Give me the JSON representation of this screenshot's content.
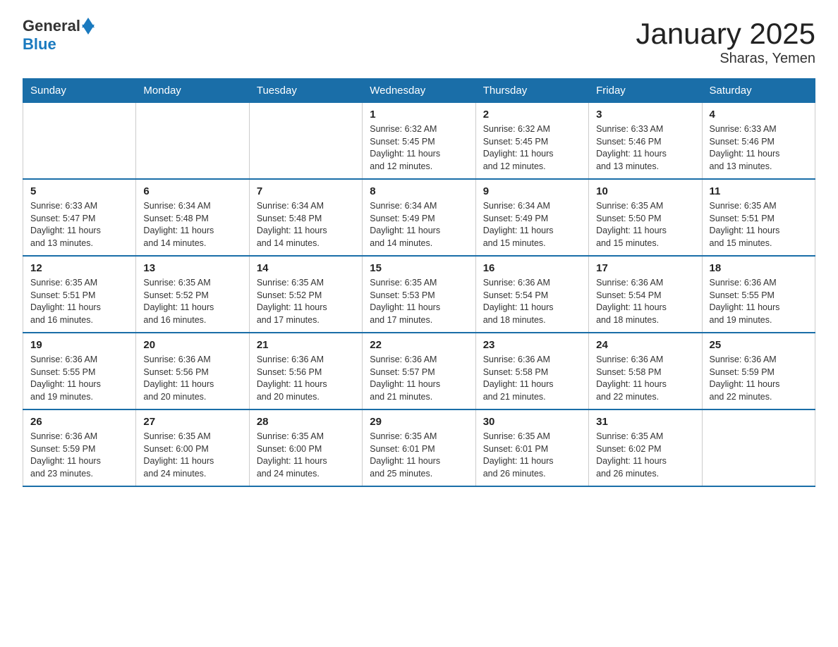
{
  "header": {
    "logo_general": "General",
    "logo_blue": "Blue",
    "month_title": "January 2025",
    "location": "Sharas, Yemen"
  },
  "days_of_week": [
    "Sunday",
    "Monday",
    "Tuesday",
    "Wednesday",
    "Thursday",
    "Friday",
    "Saturday"
  ],
  "weeks": [
    [
      {
        "day": "",
        "info": ""
      },
      {
        "day": "",
        "info": ""
      },
      {
        "day": "",
        "info": ""
      },
      {
        "day": "1",
        "info": "Sunrise: 6:32 AM\nSunset: 5:45 PM\nDaylight: 11 hours\nand 12 minutes."
      },
      {
        "day": "2",
        "info": "Sunrise: 6:32 AM\nSunset: 5:45 PM\nDaylight: 11 hours\nand 12 minutes."
      },
      {
        "day": "3",
        "info": "Sunrise: 6:33 AM\nSunset: 5:46 PM\nDaylight: 11 hours\nand 13 minutes."
      },
      {
        "day": "4",
        "info": "Sunrise: 6:33 AM\nSunset: 5:46 PM\nDaylight: 11 hours\nand 13 minutes."
      }
    ],
    [
      {
        "day": "5",
        "info": "Sunrise: 6:33 AM\nSunset: 5:47 PM\nDaylight: 11 hours\nand 13 minutes."
      },
      {
        "day": "6",
        "info": "Sunrise: 6:34 AM\nSunset: 5:48 PM\nDaylight: 11 hours\nand 14 minutes."
      },
      {
        "day": "7",
        "info": "Sunrise: 6:34 AM\nSunset: 5:48 PM\nDaylight: 11 hours\nand 14 minutes."
      },
      {
        "day": "8",
        "info": "Sunrise: 6:34 AM\nSunset: 5:49 PM\nDaylight: 11 hours\nand 14 minutes."
      },
      {
        "day": "9",
        "info": "Sunrise: 6:34 AM\nSunset: 5:49 PM\nDaylight: 11 hours\nand 15 minutes."
      },
      {
        "day": "10",
        "info": "Sunrise: 6:35 AM\nSunset: 5:50 PM\nDaylight: 11 hours\nand 15 minutes."
      },
      {
        "day": "11",
        "info": "Sunrise: 6:35 AM\nSunset: 5:51 PM\nDaylight: 11 hours\nand 15 minutes."
      }
    ],
    [
      {
        "day": "12",
        "info": "Sunrise: 6:35 AM\nSunset: 5:51 PM\nDaylight: 11 hours\nand 16 minutes."
      },
      {
        "day": "13",
        "info": "Sunrise: 6:35 AM\nSunset: 5:52 PM\nDaylight: 11 hours\nand 16 minutes."
      },
      {
        "day": "14",
        "info": "Sunrise: 6:35 AM\nSunset: 5:52 PM\nDaylight: 11 hours\nand 17 minutes."
      },
      {
        "day": "15",
        "info": "Sunrise: 6:35 AM\nSunset: 5:53 PM\nDaylight: 11 hours\nand 17 minutes."
      },
      {
        "day": "16",
        "info": "Sunrise: 6:36 AM\nSunset: 5:54 PM\nDaylight: 11 hours\nand 18 minutes."
      },
      {
        "day": "17",
        "info": "Sunrise: 6:36 AM\nSunset: 5:54 PM\nDaylight: 11 hours\nand 18 minutes."
      },
      {
        "day": "18",
        "info": "Sunrise: 6:36 AM\nSunset: 5:55 PM\nDaylight: 11 hours\nand 19 minutes."
      }
    ],
    [
      {
        "day": "19",
        "info": "Sunrise: 6:36 AM\nSunset: 5:55 PM\nDaylight: 11 hours\nand 19 minutes."
      },
      {
        "day": "20",
        "info": "Sunrise: 6:36 AM\nSunset: 5:56 PM\nDaylight: 11 hours\nand 20 minutes."
      },
      {
        "day": "21",
        "info": "Sunrise: 6:36 AM\nSunset: 5:56 PM\nDaylight: 11 hours\nand 20 minutes."
      },
      {
        "day": "22",
        "info": "Sunrise: 6:36 AM\nSunset: 5:57 PM\nDaylight: 11 hours\nand 21 minutes."
      },
      {
        "day": "23",
        "info": "Sunrise: 6:36 AM\nSunset: 5:58 PM\nDaylight: 11 hours\nand 21 minutes."
      },
      {
        "day": "24",
        "info": "Sunrise: 6:36 AM\nSunset: 5:58 PM\nDaylight: 11 hours\nand 22 minutes."
      },
      {
        "day": "25",
        "info": "Sunrise: 6:36 AM\nSunset: 5:59 PM\nDaylight: 11 hours\nand 22 minutes."
      }
    ],
    [
      {
        "day": "26",
        "info": "Sunrise: 6:36 AM\nSunset: 5:59 PM\nDaylight: 11 hours\nand 23 minutes."
      },
      {
        "day": "27",
        "info": "Sunrise: 6:35 AM\nSunset: 6:00 PM\nDaylight: 11 hours\nand 24 minutes."
      },
      {
        "day": "28",
        "info": "Sunrise: 6:35 AM\nSunset: 6:00 PM\nDaylight: 11 hours\nand 24 minutes."
      },
      {
        "day": "29",
        "info": "Sunrise: 6:35 AM\nSunset: 6:01 PM\nDaylight: 11 hours\nand 25 minutes."
      },
      {
        "day": "30",
        "info": "Sunrise: 6:35 AM\nSunset: 6:01 PM\nDaylight: 11 hours\nand 26 minutes."
      },
      {
        "day": "31",
        "info": "Sunrise: 6:35 AM\nSunset: 6:02 PM\nDaylight: 11 hours\nand 26 minutes."
      },
      {
        "day": "",
        "info": ""
      }
    ]
  ]
}
